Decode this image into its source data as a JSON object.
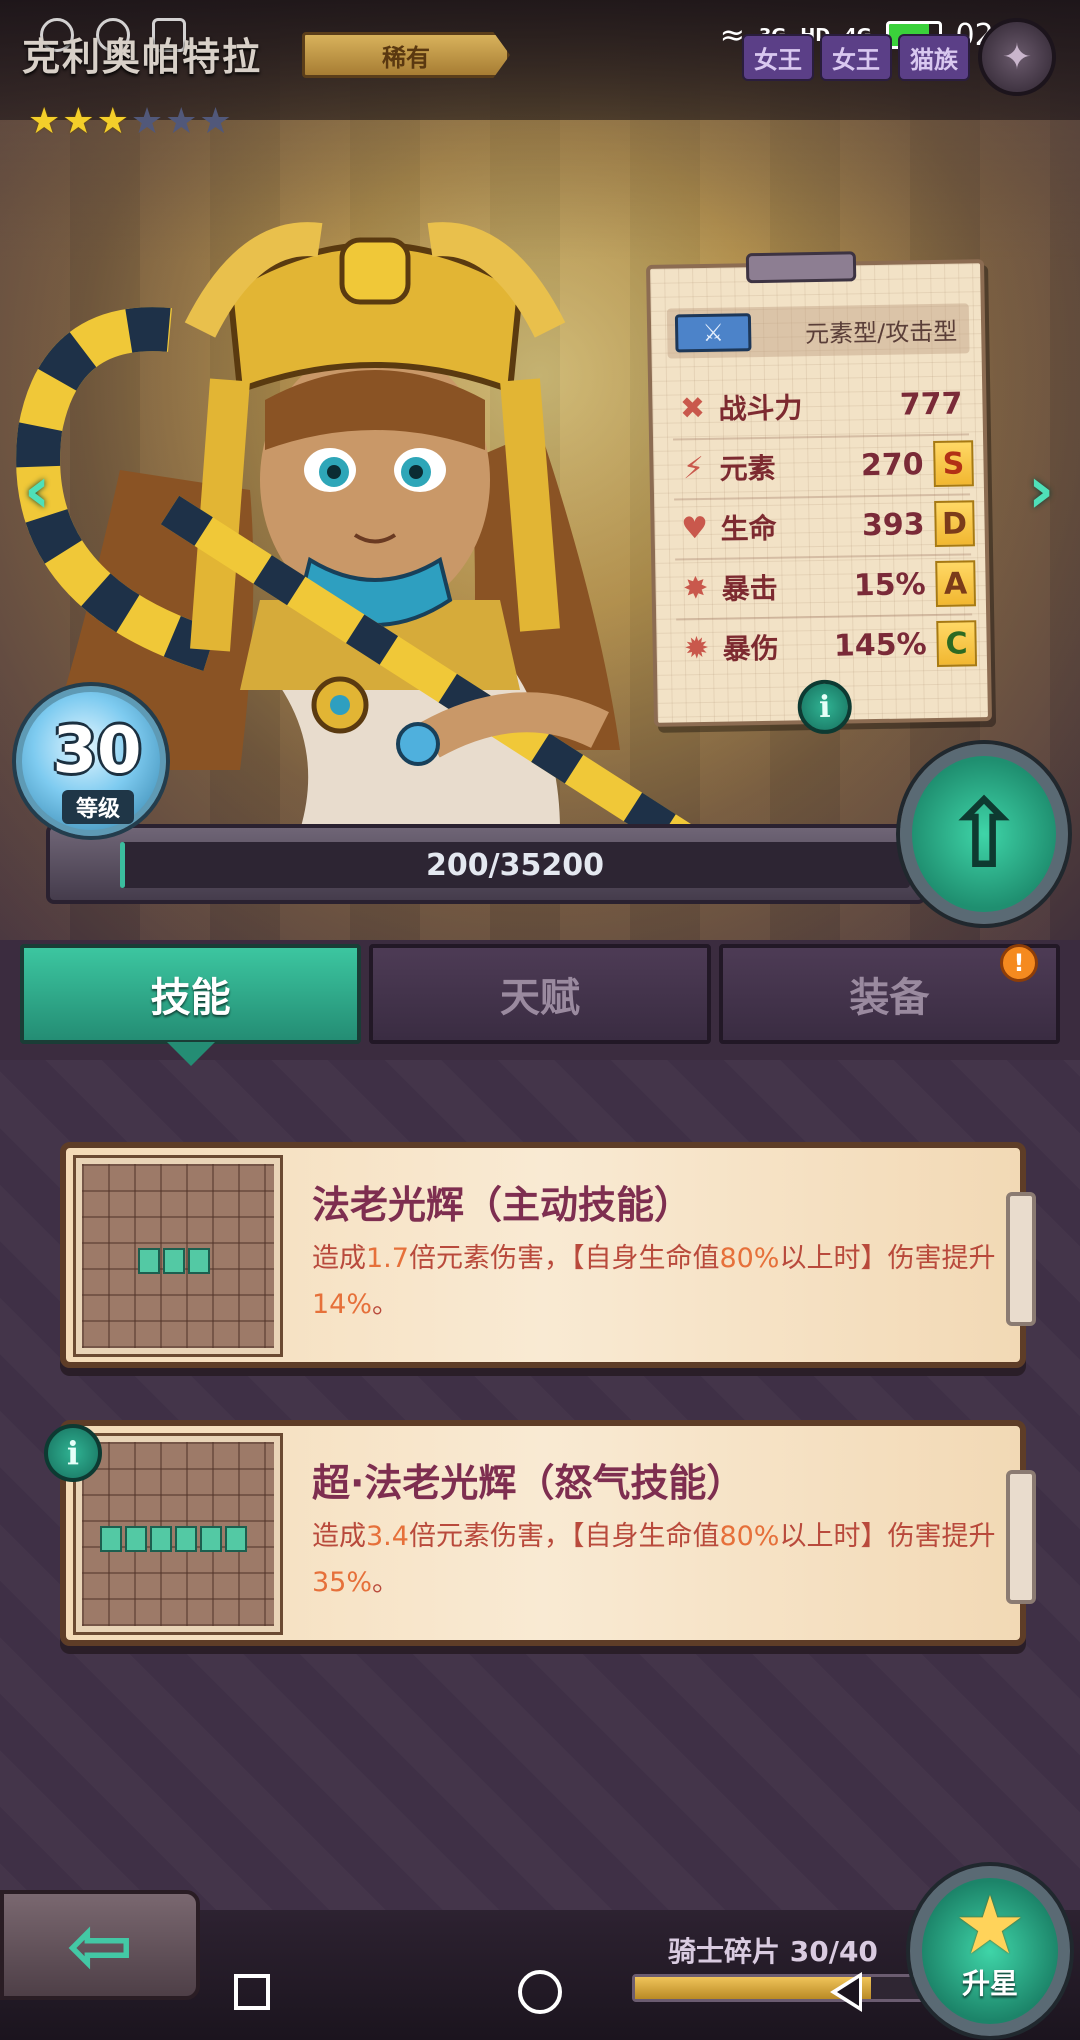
{
  "status_bar": {
    "time": "02:02",
    "network_1": "3G",
    "hd": "HD",
    "network_2": "4G"
  },
  "hero": {
    "name": "克利奥帕特拉",
    "rarity": "稀有",
    "stars_filled": 3,
    "stars_total": 6,
    "top_tags": [
      "女王",
      "女王",
      "猫族"
    ]
  },
  "stats_card": {
    "type": "元素型/攻击型",
    "rows": [
      {
        "icon": "power-icon",
        "label": "战斗力",
        "value": "777",
        "grade": ""
      },
      {
        "icon": "element-icon",
        "label": "元素",
        "value": "270",
        "grade": "S"
      },
      {
        "icon": "heart-icon",
        "label": "生命",
        "value": "393",
        "grade": "D"
      },
      {
        "icon": "crit-icon",
        "label": "暴击",
        "value": "15%",
        "grade": "A"
      },
      {
        "icon": "crit-damage-icon",
        "label": "暴伤",
        "value": "145%",
        "grade": "C"
      }
    ]
  },
  "level": {
    "value": "30",
    "label": "等级",
    "xp_text": "200/35200",
    "xp_fraction": 0.006
  },
  "tabs": [
    {
      "label": "技能",
      "active": true,
      "alert": false
    },
    {
      "label": "天赋",
      "active": false,
      "alert": false
    },
    {
      "label": "装备",
      "active": false,
      "alert": true
    }
  ],
  "alert_mark": "!",
  "info_mark": "i",
  "skills": [
    {
      "title": "法老光辉（主动技能）",
      "desc_before": "造成",
      "multiplier": "1.7",
      "desc_mid": "倍元素伤害，【自身生命值",
      "threshold": "80%",
      "desc_after": "以上时】伤害提升",
      "boost": "14%",
      "desc_end": "。",
      "blocks": 3
    },
    {
      "title": "超·法老光辉（怒气技能）",
      "desc_before": "造成",
      "multiplier": "3.4",
      "desc_mid": "倍元素伤害，【自身生命值",
      "threshold": "80%",
      "desc_after": "以上时】伤害提升",
      "boost": "35%",
      "desc_end": "。",
      "blocks": 6
    }
  ],
  "bottom": {
    "shard_label": "骑士碎片 30/40",
    "shard_fraction": 0.75,
    "starup_label": "升星"
  },
  "colors": {
    "accent_teal": "#3bbd9e",
    "star_gold": "#f4cf2a",
    "alert_orange": "#f58a1f"
  }
}
